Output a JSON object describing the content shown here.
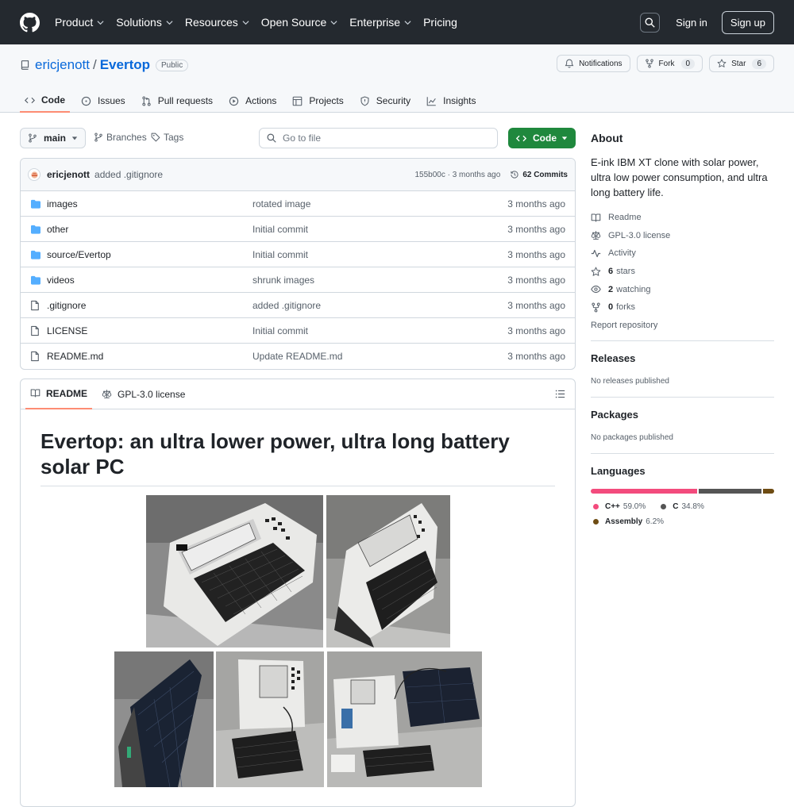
{
  "nav": {
    "items": [
      {
        "label": "Product"
      },
      {
        "label": "Solutions"
      },
      {
        "label": "Resources"
      },
      {
        "label": "Open Source"
      },
      {
        "label": "Enterprise"
      },
      {
        "label": "Pricing"
      }
    ],
    "sign_in": "Sign in",
    "sign_up": "Sign up"
  },
  "repo": {
    "owner": "ericjenott",
    "separator": "/",
    "name": "Evertop",
    "visibility": "Public",
    "notifications_label": "Notifications",
    "fork_label": "Fork",
    "fork_count": "0",
    "star_label": "Star",
    "star_count": "6"
  },
  "tabs": [
    {
      "label": "Code"
    },
    {
      "label": "Issues"
    },
    {
      "label": "Pull requests"
    },
    {
      "label": "Actions"
    },
    {
      "label": "Projects"
    },
    {
      "label": "Security"
    },
    {
      "label": "Insights"
    }
  ],
  "toolbar": {
    "branch": "main",
    "branches": "Branches",
    "tags": "Tags",
    "goto_placeholder": "Go to file",
    "code_label": "Code"
  },
  "commit": {
    "author": "ericjenott",
    "message": "added .gitignore",
    "meta": "155b00c · 3 months ago",
    "commits": "62 Commits"
  },
  "files": [
    {
      "type": "dir",
      "name": "images",
      "message": "rotated image",
      "date": "3 months ago"
    },
    {
      "type": "dir",
      "name": "other",
      "message": "Initial commit",
      "date": "3 months ago"
    },
    {
      "type": "dir",
      "name": "source/Evertop",
      "message": "Initial commit",
      "date": "3 months ago"
    },
    {
      "type": "dir",
      "name": "videos",
      "message": "shrunk images",
      "date": "3 months ago"
    },
    {
      "type": "file",
      "name": ".gitignore",
      "message": "added .gitignore",
      "date": "3 months ago"
    },
    {
      "type": "file",
      "name": "LICENSE",
      "message": "Initial commit",
      "date": "3 months ago"
    },
    {
      "type": "file",
      "name": "README.md",
      "message": "Update README.md",
      "date": "3 months ago"
    }
  ],
  "readme": {
    "tab_readme": "README",
    "tab_license": "GPL-3.0 license",
    "heading": "Evertop: an ultra lower power, ultra long battery solar PC"
  },
  "about": {
    "title": "About",
    "description": "E-ink IBM XT clone with solar power, ultra low power consumption, and ultra long battery life.",
    "readme": "Readme",
    "license": "GPL-3.0 license",
    "activity": "Activity",
    "stars_count": "6",
    "stars_label": "stars",
    "watching_count": "2",
    "watching_label": "watching",
    "forks_count": "0",
    "forks_label": "forks",
    "report": "Report repository"
  },
  "releases": {
    "title": "Releases",
    "text": "No releases published"
  },
  "packages": {
    "title": "Packages",
    "text": "No packages published"
  },
  "languages": {
    "title": "Languages",
    "items": [
      {
        "name": "C++",
        "percent": "59.0%",
        "value": 59.0,
        "color": "#f34b7d"
      },
      {
        "name": "C",
        "percent": "34.8%",
        "value": 34.8,
        "color": "#555555"
      },
      {
        "name": "Assembly",
        "percent": "6.2%",
        "value": 6.2,
        "color": "#6e4c13"
      }
    ]
  }
}
